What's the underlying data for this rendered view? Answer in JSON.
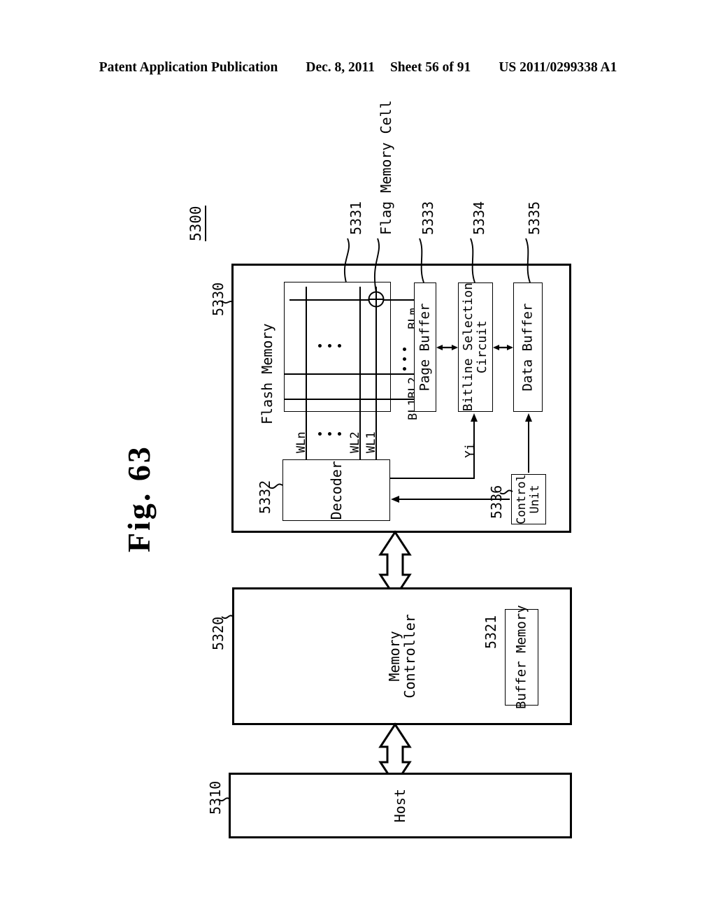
{
  "header": {
    "publication": "Patent Application Publication",
    "date": "Dec. 8, 2011",
    "sheet": "Sheet 56 of 91",
    "number": "US 2011/0299338 A1"
  },
  "figure": {
    "title": "Fig. 63",
    "system_ref": "5300"
  },
  "blocks": {
    "flash_memory": {
      "label": "Flash Memory",
      "ref": "5330"
    },
    "cell_array": {
      "ref": "5331"
    },
    "flag_memory_cell": {
      "label": "Flag Memory Cell"
    },
    "page_buffer": {
      "label": "Page Buffer",
      "ref": "5333"
    },
    "bitline_selection_circuit": {
      "label_line1": "Bitline Selection",
      "label_line2": "Circuit",
      "ref": "5334"
    },
    "data_buffer": {
      "label": "Data Buffer",
      "ref": "5335"
    },
    "decoder": {
      "label": "Decoder",
      "ref": "5332"
    },
    "control_unit": {
      "label_line1": "Control",
      "label_line2": "Unit",
      "ref": "5336"
    },
    "memory_controller": {
      "label_line1": "Memory",
      "label_line2": "Controller",
      "ref": "5320"
    },
    "buffer_memory": {
      "label": "Buffer Memory",
      "ref": "5321"
    },
    "host": {
      "label": "Host",
      "ref": "5310"
    }
  },
  "signals": {
    "wordlines": [
      "WLn",
      "WL2",
      "WL1"
    ],
    "bitlines": [
      "BLm",
      "BL2",
      "BL1"
    ],
    "column_select": "Yi"
  },
  "colors": {
    "ink": "#000000",
    "paper": "#ffffff"
  }
}
